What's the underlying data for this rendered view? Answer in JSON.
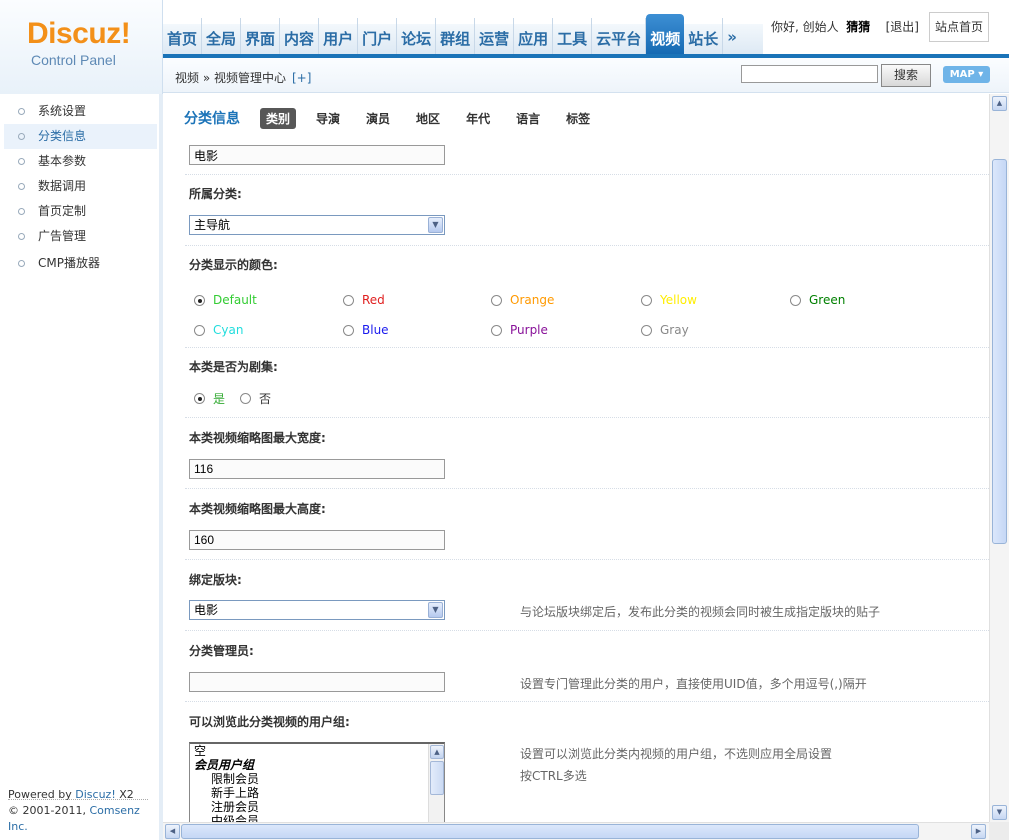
{
  "logo": {
    "brand": "Discuz!",
    "subtitle": "Control Panel"
  },
  "nav": {
    "tabs": [
      "首页",
      "全局",
      "界面",
      "内容",
      "用户",
      "门户",
      "论坛",
      "群组",
      "运营",
      "应用",
      "工具",
      "云平台",
      "视频",
      "站长",
      "»"
    ],
    "active_index": 12
  },
  "user": {
    "greeting": "你好, 创始人",
    "name": "猜猜",
    "logout": "[退出]",
    "site_home": "站点首页"
  },
  "breadcrumb": {
    "path": "视频 » 视频管理中心",
    "add": "[+]"
  },
  "search": {
    "value": "",
    "button": "搜索",
    "map": "MAP ▾"
  },
  "sidebar": {
    "items": [
      "系统设置",
      "分类信息",
      "基本参数",
      "数据调用",
      "首页定制",
      "广告管理",
      "CMP播放器"
    ],
    "active_index": 1,
    "footer_line1_prefix": "Powered by ",
    "footer_line1_link": "Discuz!",
    "footer_line1_suffix": " X2",
    "footer_line2_prefix": "© 2001-2011, ",
    "footer_line2_link": "Comsenz Inc."
  },
  "main": {
    "title": "分类信息",
    "tabs": [
      "类别",
      "导演",
      "演员",
      "地区",
      "年代",
      "语言",
      "标签"
    ],
    "active_tab": 0,
    "category_name": "电影",
    "parent_label": "所属分类:",
    "parent_value": "主导航",
    "color_label": "分类显示的颜色:",
    "colors": [
      {
        "name": "Default",
        "hex": "#33cc33",
        "checked": true
      },
      {
        "name": "Red",
        "hex": "#e02020",
        "checked": false
      },
      {
        "name": "Orange",
        "hex": "#ff9900",
        "checked": false
      },
      {
        "name": "Yellow",
        "hex": "#ffee00",
        "checked": false
      },
      {
        "name": "Green",
        "hex": "#008000",
        "checked": false
      },
      {
        "name": "Cyan",
        "hex": "#22dddd",
        "checked": false
      },
      {
        "name": "Blue",
        "hex": "#1a1aee",
        "checked": false
      },
      {
        "name": "Purple",
        "hex": "#881199",
        "checked": false
      },
      {
        "name": "Gray",
        "hex": "#888888",
        "checked": false
      }
    ],
    "series_label": "本类是否为剧集:",
    "series_yes": "是",
    "series_no": "否",
    "thumb_width_label": "本类视频缩略图最大宽度:",
    "thumb_width": "116",
    "thumb_height_label": "本类视频缩略图最大高度:",
    "thumb_height": "160",
    "bind_forum_label": "绑定版块:",
    "bind_forum_value": "电影",
    "bind_forum_hint": "与论坛版块绑定后，发布此分类的视频会同时被生成指定版块的贴子",
    "moderator_label": "分类管理员:",
    "moderator_value": "",
    "moderator_hint": "设置专门管理此分类的用户，直接使用UID值，多个用逗号(,)隔开",
    "groups_label": "可以浏览此分类视频的用户组:",
    "groups_hint1": "设置可以浏览此分类内视频的用户组，不选则应用全局设置",
    "groups_hint2": "按CTRL多选",
    "groups_options": [
      "空",
      "会员用户组",
      "限制会员",
      "新手上路",
      "注册会员",
      "中级会员"
    ]
  }
}
